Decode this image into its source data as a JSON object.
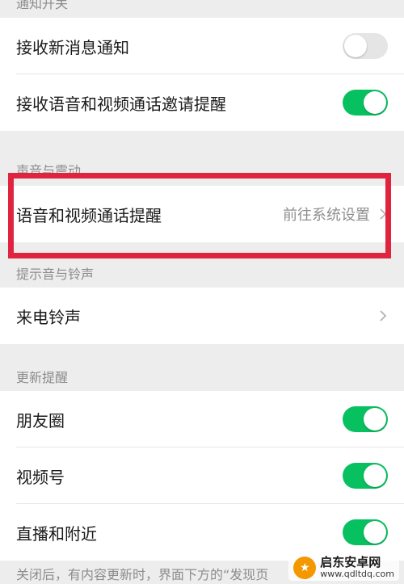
{
  "sections": {
    "notifications": "通知开关",
    "sound": "声音与震动",
    "tones": "提示音与铃声",
    "updates": "更新提醒"
  },
  "rows": {
    "receive_new_msg": {
      "label": "接收新消息通知",
      "toggle": "off"
    },
    "receive_call_invite": {
      "label": "接收语音和视频通话邀请提醒",
      "toggle": "on"
    },
    "call_reminder": {
      "label": "语音和视频通话提醒",
      "value": "前往系统设置"
    },
    "ringtone": {
      "label": "来电铃声"
    },
    "moments": {
      "label": "朋友圈",
      "toggle": "on"
    },
    "channels": {
      "label": "视频号",
      "toggle": "on"
    },
    "live_nearby": {
      "label": "直播和附近",
      "toggle": "on"
    }
  },
  "footer_note": "关闭后，有内容更新时，界面下方的“发现页",
  "watermark": {
    "title": "启东安卓网",
    "url": "www.qdltdq.com"
  },
  "colors": {
    "toggle_on": "#07c160",
    "toggle_off": "#e5e5e5",
    "highlight": "#e0243f"
  }
}
